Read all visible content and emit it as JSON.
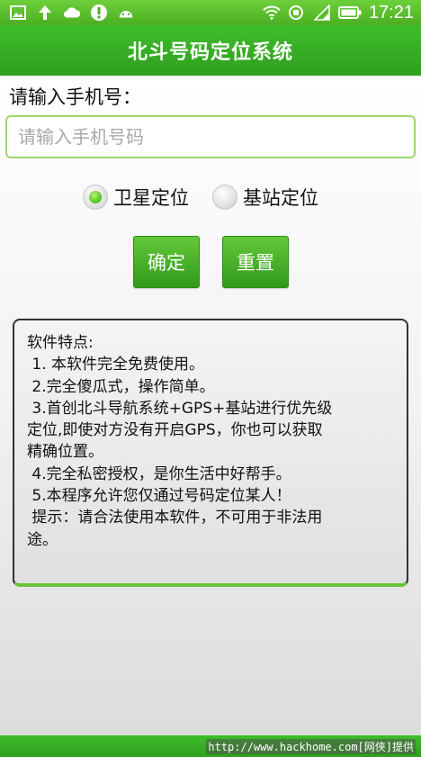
{
  "status_bar": {
    "time": "17:21",
    "icons": [
      "picture-icon",
      "upload-arrow-icon",
      "cloud-icon",
      "alert-icon",
      "android-icon",
      "wifi-icon",
      "sim-icon",
      "signal-icon",
      "battery-icon"
    ]
  },
  "title": "北斗号码定位系统",
  "form": {
    "label": "请输入手机号：",
    "input_value": "",
    "input_placeholder": "请输入手机号码",
    "radio_options": [
      {
        "label": "卫星定位",
        "selected": true
      },
      {
        "label": "基站定位",
        "selected": false
      }
    ],
    "confirm_label": "确定",
    "reset_label": "重置"
  },
  "info": {
    "lines": [
      "软件特点:",
      " 1. 本软件完全免费使用。",
      " 2.完全傻瓜式，操作简单。",
      " 3.首创北斗导航系统+GPS+基站进行优先级",
      "定位,即使对方没有开启GPS，你也可以获取",
      "精确位置。",
      " 4.完全私密授权，是你生活中好帮手。",
      " 5.本程序允许您仅通过号码定位某人！",
      " 提示：请合法使用本软件，不可用于非法用",
      "途。"
    ]
  },
  "watermark": "http://www.hackhome.com[网侠]提供",
  "colors": {
    "accent_green": "#3fbd2b",
    "border_green": "#9ed66f"
  }
}
